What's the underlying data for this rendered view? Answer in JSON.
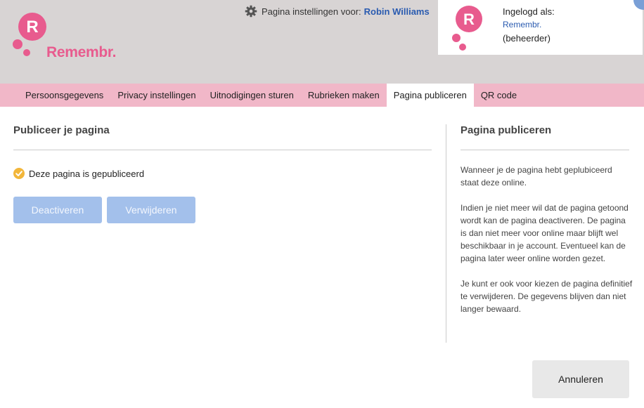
{
  "brand": {
    "name": "Remembr.",
    "logo_letter": "R",
    "color": "#e85b8e"
  },
  "header": {
    "settings_label": "Pagina instellingen voor:",
    "settings_user": "Robin Williams",
    "settings_icon": "gear-icon"
  },
  "login": {
    "label": "Ingelogd als:",
    "name": "Remembr.",
    "role": "(beheerder)"
  },
  "tabs": [
    {
      "label": "Persoonsgegevens",
      "active": false
    },
    {
      "label": "Privacy instellingen",
      "active": false
    },
    {
      "label": "Uitnodigingen sturen",
      "active": false
    },
    {
      "label": "Rubrieken maken",
      "active": false
    },
    {
      "label": "Pagina publiceren",
      "active": true
    },
    {
      "label": "QR code",
      "active": false
    }
  ],
  "main": {
    "title": "Publiceer je pagina",
    "status_text": "Deze pagina is gepubliceerd",
    "status_icon": "check-circle-icon",
    "deactivate_label": "Deactiveren",
    "delete_label": "Verwijderen"
  },
  "sidebar": {
    "title": "Pagina publiceren",
    "paragraphs": [
      "Wanneer je de pagina hebt geplubiceerd staat deze online.",
      "Indien je niet meer wil dat de pagina getoond wordt kan de pagina deactiveren. De pagina is dan niet meer voor online maar blijft wel beschikbaar in je account. Eventueel kan de pagina later weer online worden gezet.",
      "Je kunt er ook voor kiezen de pagina definitief te verwijderen. De gegevens blijven dan niet langer bewaard."
    ]
  },
  "footer": {
    "cancel_label": "Annuleren"
  },
  "colors": {
    "header_bg": "#d8d4d4",
    "tab_bar_bg": "#f1b7c8",
    "primary_button_bg": "#a3c0eb",
    "link": "#2a5bb0"
  }
}
